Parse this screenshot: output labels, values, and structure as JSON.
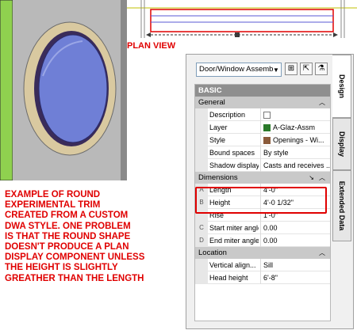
{
  "plan_view": {
    "title": "PLAN VIEW"
  },
  "caption": {
    "lines": [
      "EXAMPLE OF ROUND",
      "EXPERIMENTAL TRIM",
      "CREATED FROM A CUSTOM",
      "DWA STYLE.  ONE PROBLEM",
      "IS THAT THE ROUND SHAPE",
      "DOESN'T PRODUCE A PLAN",
      "DISPLAY COMPONENT UNLESS",
      "THE HEIGHT IS SLIGHTLY",
      "GREATHER THAN THE LENGTH"
    ]
  },
  "palette": {
    "type_select": "Door/Window Assemb",
    "tabs": {
      "design": "Design",
      "display": "Display",
      "extended": "Extended Data"
    },
    "basic": "BASIC",
    "general": {
      "title": "General",
      "rows": [
        {
          "label": "Description",
          "value": ""
        },
        {
          "label": "Layer",
          "value": "A-Glaz-Assm"
        },
        {
          "label": "Style",
          "value": "Openings - Wi..."
        },
        {
          "label": "Bound spaces",
          "value": "By style"
        },
        {
          "label": "Shadow display",
          "value": "Casts and receives ..."
        }
      ]
    },
    "dimensions": {
      "title": "Dimensions",
      "rows": [
        {
          "key": "A",
          "label": "Length",
          "value": "4'-0\""
        },
        {
          "key": "B",
          "label": "Height",
          "value": "4'-0 1/32\""
        },
        {
          "key": "",
          "label": "Rise",
          "value": "1'-0\""
        },
        {
          "key": "C",
          "label": "Start miter angle",
          "value": "0.00"
        },
        {
          "key": "D",
          "label": "End miter angle",
          "value": "0.00"
        }
      ]
    },
    "location": {
      "title": "Location",
      "rows": [
        {
          "label": "Vertical align...",
          "value": "Sill"
        },
        {
          "label": "Head height",
          "value": "6'-8\""
        }
      ]
    }
  },
  "colors": {
    "accent": "#e00000",
    "layer_swatch": "#2a7a2a",
    "wall_green": "#8fd14f",
    "glass_blue": "#6f7fd6"
  }
}
